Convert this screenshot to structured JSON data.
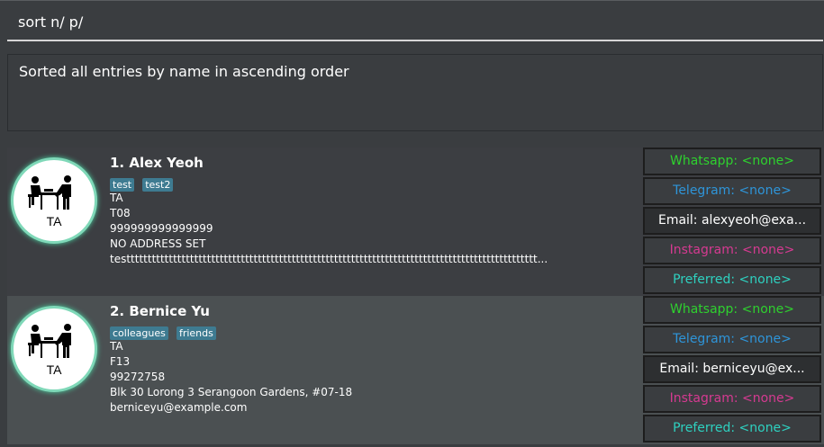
{
  "command": {
    "value": "sort n/ p/"
  },
  "result": {
    "text": "Sorted all entries by name in ascending order"
  },
  "persons": [
    {
      "index_name": "1.  Alex Yeoh",
      "avatar_label": "TA",
      "tags": [
        "test",
        "test2"
      ],
      "role": "TA",
      "tutorial": "T08",
      "phone": "999999999999999",
      "address": "NO ADDRESS SET",
      "email": "testtttttttttttttttttttttttttttttttttttttttttttttttttttttttttttttttttttttttttttttttttttttttttttttttt...",
      "socials": {
        "whatsapp": "Whatsapp: <none>",
        "telegram": "Telegram: <none>",
        "email": "Email: alexyeoh@exa...",
        "instagram": "Instagram: <none>",
        "preferred": "Preferred: <none>"
      }
    },
    {
      "index_name": "2.  Bernice Yu",
      "avatar_label": "TA",
      "tags": [
        "colleagues",
        "friends"
      ],
      "role": "TA",
      "tutorial": "F13",
      "phone": "99272758",
      "address": "Blk 30 Lorong 3 Serangoon Gardens, #07-18",
      "email": "berniceyu@example.com",
      "socials": {
        "whatsapp": "Whatsapp: <none>",
        "telegram": "Telegram: <none>",
        "email": "Email: berniceyu@ex...",
        "instagram": "Instagram: <none>",
        "preferred": "Preferred: <none>"
      }
    }
  ],
  "colors": {
    "whatsapp": "#2ed12e",
    "telegram": "#2e95d9",
    "instagram": "#d63a91",
    "preferred": "#2ed1c0",
    "tag": "#3e7b91"
  }
}
